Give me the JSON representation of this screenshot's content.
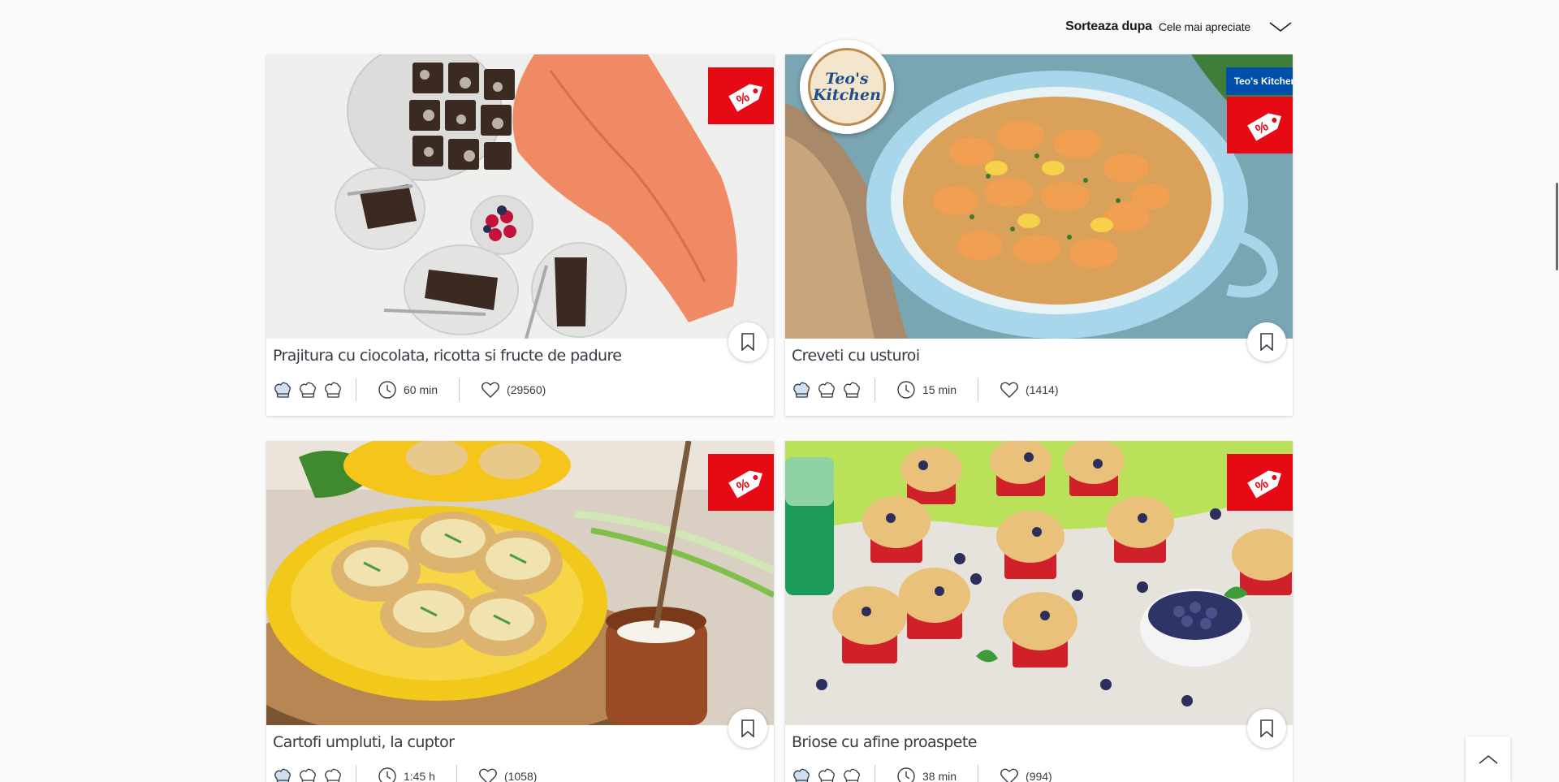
{
  "sort": {
    "label": "Sorteaza dupa",
    "value": "Cele mai apreciate",
    "icon": "chevron-down-icon"
  },
  "recipes": [
    {
      "title": "Prajitura cu ciocolata, ricotta si fructe de padure",
      "time": "60 min",
      "likes": "(29560)",
      "difficulty_filled": 1,
      "difficulty_max": 3,
      "promo": true,
      "brand": null
    },
    {
      "title": "Creveti cu usturoi",
      "time": "15 min",
      "likes": "(1414)",
      "difficulty_filled": 1,
      "difficulty_max": 3,
      "promo": true,
      "brand": "Teo's Kitchen",
      "logo_line1": "Teo's",
      "logo_line2": "Kitchen"
    },
    {
      "title": "Cartofi umpluti, la cuptor",
      "time": "1:45 h",
      "likes": "(1058)",
      "difficulty_filled": 1,
      "difficulty_max": 3,
      "promo": true,
      "brand": null
    },
    {
      "title": "Briose cu afine proaspete",
      "time": "38 min",
      "likes": "(994)",
      "difficulty_filled": 1,
      "difficulty_max": 3,
      "promo": true,
      "brand": null
    }
  ],
  "colors": {
    "promo_red": "#e60a14",
    "brand_blue": "#0050aa",
    "hat_blue": "#cfe0f0"
  },
  "icons": {
    "promo": "percent-tag-icon",
    "bookmark": "bookmark-icon",
    "clock": "clock-icon",
    "heart": "heart-icon",
    "hat": "chef-hat-icon",
    "scroll_top": "chevron-up-icon"
  }
}
